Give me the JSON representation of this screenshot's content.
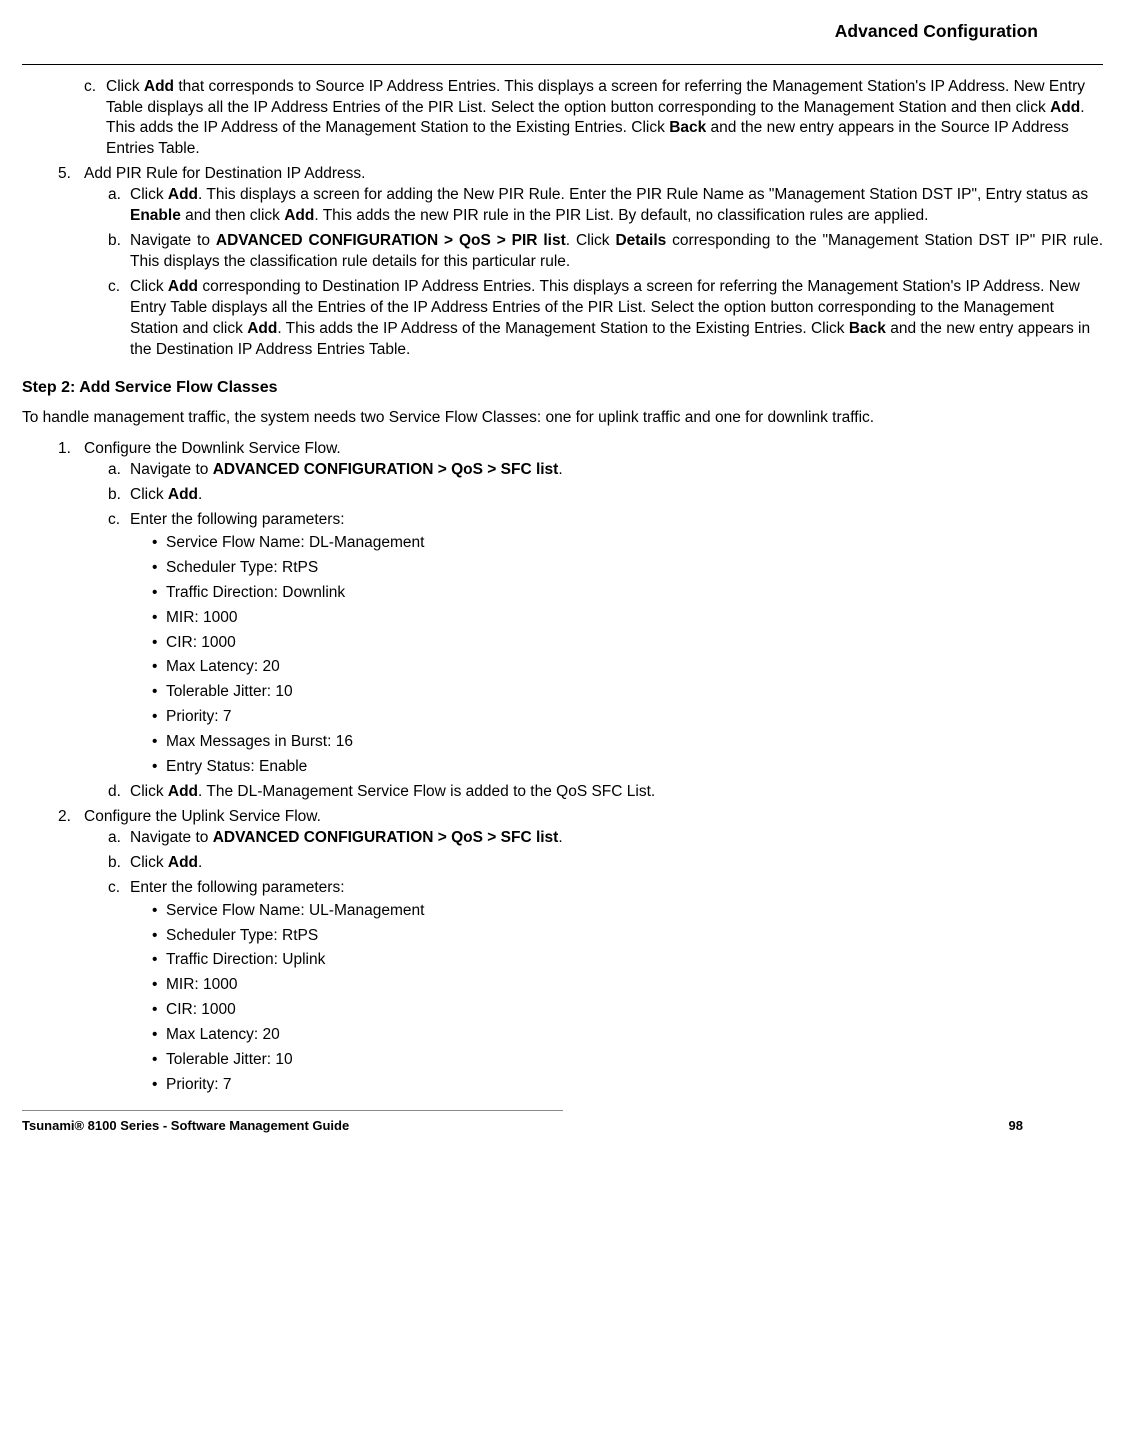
{
  "header": "Advanced Configuration",
  "sec1": {
    "c_pre": "Click ",
    "c_b1": "Add",
    "c_mid1": " that corresponds to Source IP Address Entries. This displays a screen for referring the Management Station's IP Address. New Entry Table displays all the IP Address Entries of the PIR List. Select the option button corresponding to the Management Station and then click ",
    "c_b2": "Add",
    "c_mid2": ". This adds the IP Address of the Management Station to the Existing Entries. Click ",
    "c_b3": "Back",
    "c_post": " and the new entry appears in the Source IP Address Entries Table."
  },
  "step5": {
    "title": "Add PIR Rule for Destination IP Address.",
    "a_pre": "Click ",
    "a_b1": "Add",
    "a_mid1": ". This displays a screen for adding the New PIR Rule. Enter the PIR Rule Name as \"Management Station DST IP\", Entry status as ",
    "a_b2": "Enable",
    "a_mid2": " and then click ",
    "a_b3": "Add",
    "a_post": ". This adds the new PIR rule in the PIR List. By default, no classification rules are applied.",
    "b_pre": "Navigate to ",
    "b_b1": "ADVANCED CONFIGURATION > QoS > PIR list",
    "b_mid1": ". Click ",
    "b_b2": "Details",
    "b_post": " corresponding to the \"Management Station DST IP\" PIR rule. This displays the classification rule details for this particular rule.",
    "c_pre": "Click ",
    "c_b1": "Add",
    "c_mid1": " corresponding to Destination IP Address Entries. This displays a screen for referring the Management Station's IP Address. New Entry Table displays all the Entries of the IP Address Entries of the PIR List. Select the option button corresponding to the Management Station and click ",
    "c_b2": "Add",
    "c_mid2": ". This adds the IP Address of the Management Station to the Existing Entries. Click ",
    "c_b3": "Back",
    "c_post": " and the new entry appears in the Destination IP Address Entries Table."
  },
  "step2heading": "Step 2: Add Service Flow Classes",
  "step2intro": "To handle management traffic, the system needs two Service Flow Classes: one for uplink traffic and one for downlink traffic.",
  "sfc1": {
    "title": "Configure the Downlink Service Flow.",
    "a_pre": "Navigate to ",
    "a_b": "ADVANCED CONFIGURATION > QoS > SFC list",
    "a_post": ".",
    "b_pre": "Click ",
    "b_b": "Add",
    "b_post": ".",
    "c": "Enter the following parameters:",
    "params": [
      "Service Flow Name: DL-Management",
      "Scheduler Type: RtPS",
      "Traffic Direction: Downlink",
      "MIR: 1000",
      "CIR: 1000",
      "Max Latency: 20",
      "Tolerable Jitter: 10",
      "Priority: 7",
      "Max Messages in Burst: 16",
      "Entry Status: Enable"
    ],
    "d_pre": "Click ",
    "d_b": "Add",
    "d_post": ". The DL-Management Service Flow is added to the QoS SFC List."
  },
  "sfc2": {
    "title": "Configure the Uplink Service Flow.",
    "a_pre": "Navigate to ",
    "a_b": "ADVANCED CONFIGURATION > QoS > SFC list",
    "a_post": ".",
    "b_pre": "Click ",
    "b_b": "Add",
    "b_post": ".",
    "c": "Enter the following parameters:",
    "params": [
      "Service Flow Name: UL-Management",
      "Scheduler Type: RtPS",
      "Traffic Direction: Uplink",
      "MIR: 1000",
      "CIR: 1000",
      "Max Latency: 20",
      "Tolerable Jitter: 10",
      "Priority: 7"
    ]
  },
  "footer_left": "Tsunami® 8100 Series - Software Management Guide",
  "footer_right": "98"
}
